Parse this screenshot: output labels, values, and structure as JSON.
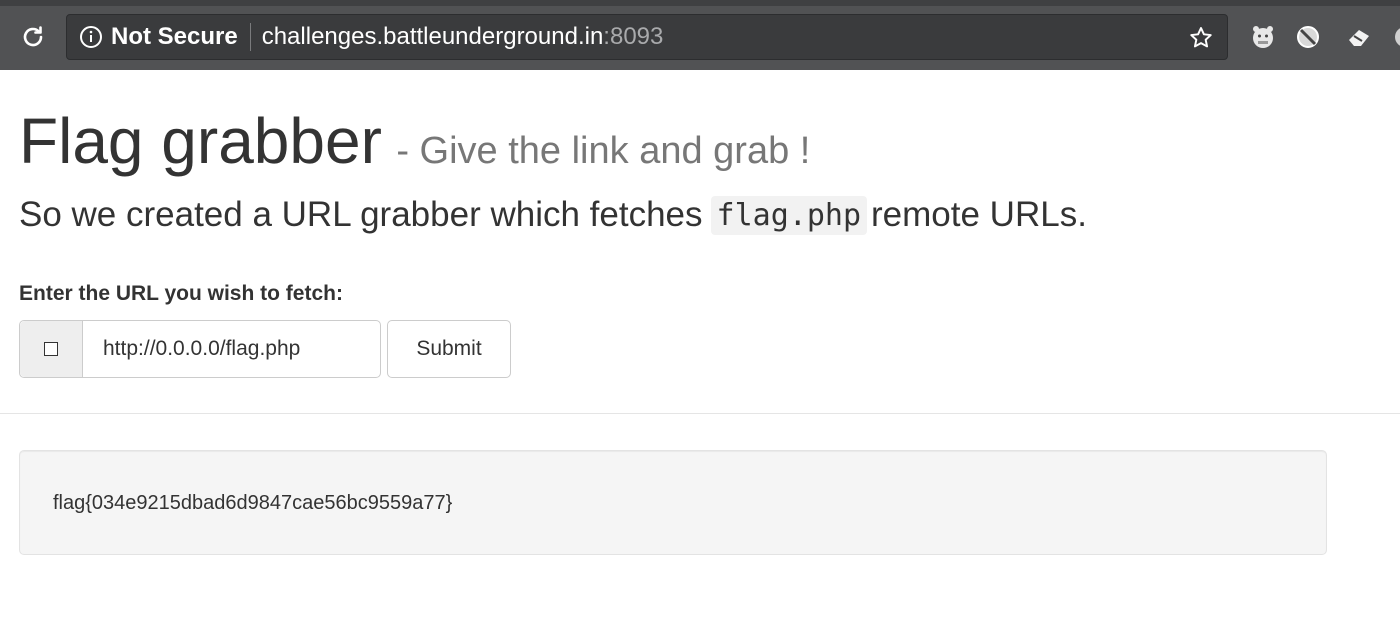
{
  "browser": {
    "security_label": "Not Secure",
    "url_host": "challenges.battleunderground.in",
    "url_port": ":8093",
    "icons": [
      "reload-icon",
      "info-icon",
      "star-icon",
      "extension-icons"
    ]
  },
  "header": {
    "title": "Flag grabber",
    "subtitle": "- Give the link and grab !"
  },
  "lead": {
    "prefix": "So we created a URL grabber which fetches",
    "code": "flag.php",
    "suffix": "remote URLs."
  },
  "form": {
    "label": "Enter the URL you wish to fetch:",
    "url_value": "http://0.0.0.0/flag.php",
    "submit_label": "Submit"
  },
  "result": {
    "text": "flag{034e9215dbad6d9847cae56bc9559a77}"
  },
  "colors": {
    "browser_bar": "#515254",
    "text": "#333333",
    "subtitle": "#777777",
    "well_bg": "#f5f5f5"
  }
}
